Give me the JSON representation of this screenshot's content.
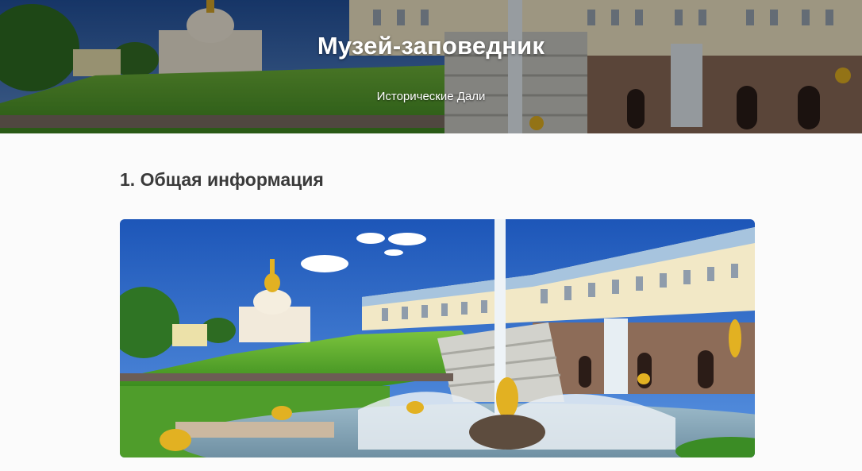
{
  "header": {
    "title": "Музей-заповедник",
    "subtitle": "Исторические Дали"
  },
  "sections": [
    {
      "heading": "1. Общая информация",
      "image_alt": "Peterhof Grand Cascade with golden fountains and palace"
    }
  ],
  "colors": {
    "page_background": "#fbfbfb",
    "heading_text": "#3a3a3a",
    "header_text": "#ffffff",
    "sky": "#2d5fa8",
    "lawn": "#4e9e2c",
    "gold": "#e2b122"
  }
}
